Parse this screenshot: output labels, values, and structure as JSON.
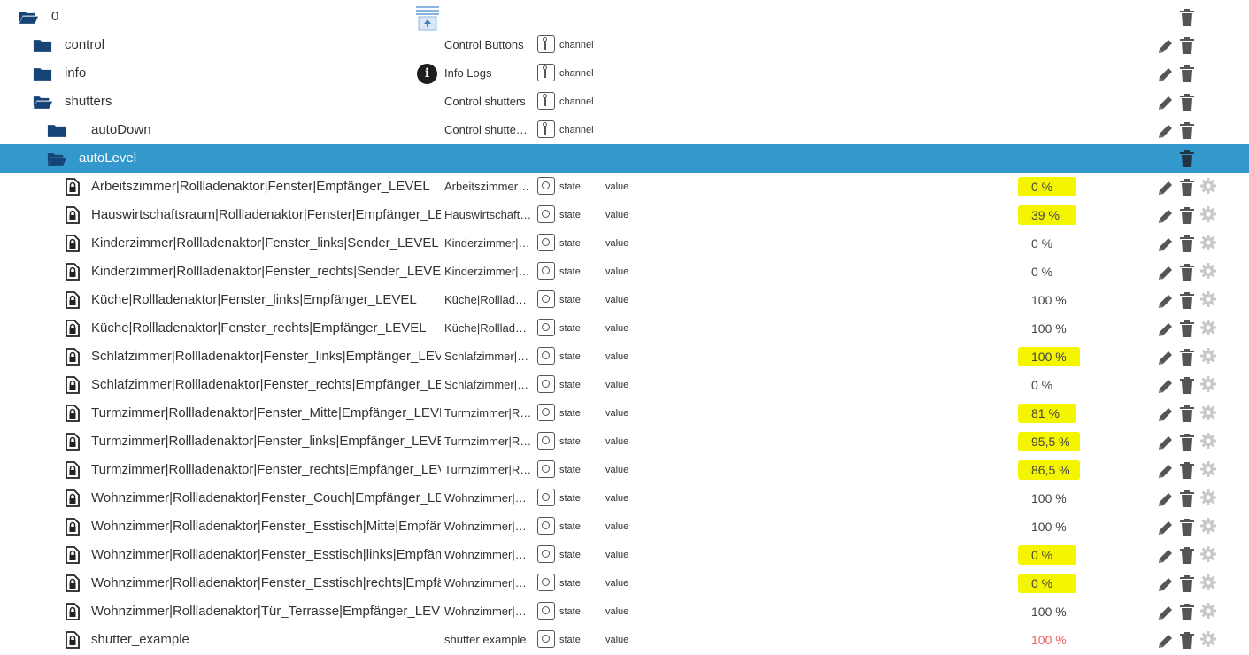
{
  "tree": {
    "root": {
      "label": "0"
    },
    "folders": [
      {
        "id": "control",
        "label": "control",
        "desc": "Control Buttons",
        "type": "channel"
      },
      {
        "id": "info",
        "label": "info",
        "desc": "Info Logs",
        "type": "channel",
        "icon": "info-icon"
      },
      {
        "id": "shutters",
        "label": "shutters",
        "desc": "Control shutters",
        "type": "channel"
      },
      {
        "id": "autodown",
        "label": "autoDown",
        "desc": "Control shutte…",
        "type": "channel"
      },
      {
        "id": "autolevel",
        "label": "autoLevel",
        "selected": true
      }
    ],
    "states": [
      {
        "name": "Arbeitszimmer|Rollladenaktor|Fenster|Empfänger_LEVEL",
        "desc": "Arbeitszimmer…",
        "type": "state",
        "role": "value",
        "value": "0 %",
        "highlight": true
      },
      {
        "name": "Hauswirtschaftsraum|Rollladenaktor|Fenster|Empfänger_LEVEL",
        "desc": "Hauswirtschaft…",
        "type": "state",
        "role": "value",
        "value": "39 %",
        "highlight": true
      },
      {
        "name": "Kinderzimmer|Rollladenaktor|Fenster_links|Sender_LEVEL",
        "desc": "Kinderzimmer|…",
        "type": "state",
        "role": "value",
        "value": "0 %",
        "highlight": false
      },
      {
        "name": "Kinderzimmer|Rollladenaktor|Fenster_rechts|Sender_LEVEL",
        "desc": "Kinderzimmer|…",
        "type": "state",
        "role": "value",
        "value": "0 %",
        "highlight": false
      },
      {
        "name": "Küche|Rollladenaktor|Fenster_links|Empfänger_LEVEL",
        "desc": "Küche|Rolllade…",
        "type": "state",
        "role": "value",
        "value": "100 %",
        "highlight": false
      },
      {
        "name": "Küche|Rollladenaktor|Fenster_rechts|Empfänger_LEVEL",
        "desc": "Küche|Rolllade…",
        "type": "state",
        "role": "value",
        "value": "100 %",
        "highlight": false
      },
      {
        "name": "Schlafzimmer|Rollladenaktor|Fenster_links|Empfänger_LEVEL",
        "desc": "Schlafzimmer|…",
        "type": "state",
        "role": "value",
        "value": "100 %",
        "highlight": true
      },
      {
        "name": "Schlafzimmer|Rollladenaktor|Fenster_rechts|Empfänger_LEVEL",
        "desc": "Schlafzimmer|…",
        "type": "state",
        "role": "value",
        "value": "0 %",
        "highlight": false
      },
      {
        "name": "Turmzimmer|Rollladenaktor|Fenster_Mitte|Empfänger_LEVEL",
        "desc": "Turmzimmer|R…",
        "type": "state",
        "role": "value",
        "value": "81 %",
        "highlight": true
      },
      {
        "name": "Turmzimmer|Rollladenaktor|Fenster_links|Empfänger_LEVEL",
        "desc": "Turmzimmer|R…",
        "type": "state",
        "role": "value",
        "value": "95,5 %",
        "highlight": true
      },
      {
        "name": "Turmzimmer|Rollladenaktor|Fenster_rechts|Empfänger_LEVEL",
        "desc": "Turmzimmer|R…",
        "type": "state",
        "role": "value",
        "value": "86,5 %",
        "highlight": true
      },
      {
        "name": "Wohnzimmer|Rollladenaktor|Fenster_Couch|Empfänger_LEVEL",
        "desc": "Wohnzimmer|…",
        "type": "state",
        "role": "value",
        "value": "100 %",
        "highlight": false
      },
      {
        "name": "Wohnzimmer|Rollladenaktor|Fenster_Esstisch|Mitte|Empfänger_LEVEL",
        "desc": "Wohnzimmer|…",
        "type": "state",
        "role": "value",
        "value": "100 %",
        "highlight": false
      },
      {
        "name": "Wohnzimmer|Rollladenaktor|Fenster_Esstisch|links|Empfänger_LEVEL",
        "desc": "Wohnzimmer|…",
        "type": "state",
        "role": "value",
        "value": "0 %",
        "highlight": true
      },
      {
        "name": "Wohnzimmer|Rollladenaktor|Fenster_Esstisch|rechts|Empfänger_LEVEL",
        "desc": "Wohnzimmer|…",
        "type": "state",
        "role": "value",
        "value": "0 %",
        "highlight": true
      },
      {
        "name": "Wohnzimmer|Rollladenaktor|Tür_Terrasse|Empfänger_LEVEL",
        "desc": "Wohnzimmer|…",
        "type": "state",
        "role": "value",
        "value": "100 %",
        "highlight": false
      },
      {
        "name": "shutter_example",
        "desc": "shutter example",
        "type": "state",
        "role": "value",
        "value": "100 %",
        "highlight": false,
        "value_color": "#f06060"
      }
    ]
  },
  "colors": {
    "selected_row": "#3399cc",
    "folder": "#164477",
    "highlight": "#f5f500",
    "action_icon": "#555555"
  },
  "icons": {
    "edit": "pencil-icon",
    "delete": "trash-icon",
    "settings": "gear-icon",
    "folder": "folder-icon",
    "folder_open": "folder-open-icon",
    "file": "file-lock-icon",
    "role": "role-icon"
  }
}
